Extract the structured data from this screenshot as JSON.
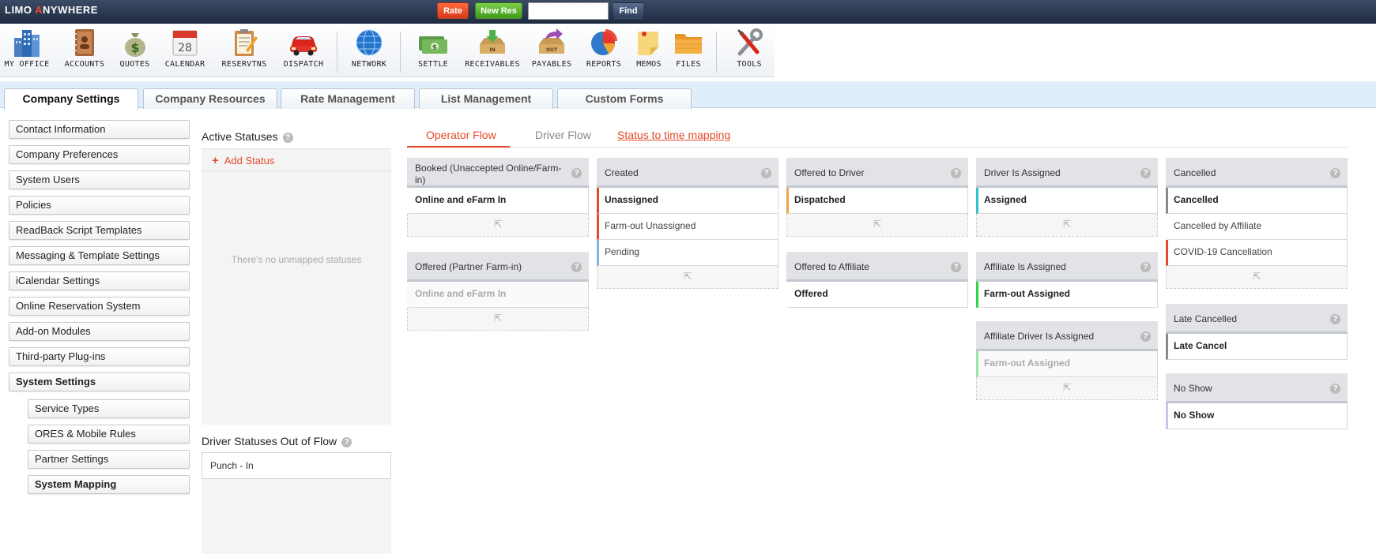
{
  "topbar": {
    "logo_left": "LIMO ",
    "logo_accent": "A",
    "logo_right": "NYWHERE",
    "rate_label": "Rate",
    "new_res_label": "New Res",
    "search_value": "",
    "find_label": "Find"
  },
  "toolbar": [
    {
      "label": "MY OFFICE",
      "icon": "office-building-icon"
    },
    {
      "label": "ACCOUNTS",
      "icon": "address-book-icon"
    },
    {
      "label": "QUOTES",
      "icon": "money-bag-icon"
    },
    {
      "label": "CALENDAR",
      "icon": "calendar-icon",
      "day": "28"
    },
    {
      "label": "RESERVTNS",
      "icon": "clipboard-icon"
    },
    {
      "label": "DISPATCH",
      "icon": "car-icon"
    },
    {
      "label": "NETWORK",
      "icon": "globe-icon"
    },
    {
      "label": "SETTLE",
      "icon": "cash-icon"
    },
    {
      "label": "RECEIVABLES",
      "icon": "inbox-tray-icon",
      "tag": "IN"
    },
    {
      "label": "PAYABLES",
      "icon": "outbox-tray-icon",
      "tag": "OUT"
    },
    {
      "label": "REPORTS",
      "icon": "pie-chart-icon"
    },
    {
      "label": "MEMOS",
      "icon": "sticky-note-icon"
    },
    {
      "label": "FILES",
      "icon": "folder-icon"
    },
    {
      "label": "TOOLS",
      "icon": "wrench-screwdriver-icon"
    }
  ],
  "tabs": [
    {
      "label": "Company Settings",
      "active": true
    },
    {
      "label": "Company Resources"
    },
    {
      "label": "Rate Management"
    },
    {
      "label": "List Management"
    },
    {
      "label": "Custom Forms"
    }
  ],
  "sidebar": {
    "items": [
      "Contact Information",
      "Company Preferences",
      "System Users",
      "Policies",
      "ReadBack Script Templates",
      "Messaging & Template Settings",
      "iCalendar Settings",
      "Online Reservation System",
      "Add-on Modules",
      "Third-party Plug-ins",
      "System Settings"
    ],
    "subitems": [
      "Service Types",
      "ORES & Mobile Rules",
      "Partner Settings",
      "System Mapping"
    ]
  },
  "active_statuses": {
    "title": "Active Statuses",
    "help": "?",
    "add_label": "Add Status",
    "add_icon": "+",
    "empty_text": "There's no unmapped statuses"
  },
  "driver_out_of_flow": {
    "title": "Driver Statuses Out of Flow",
    "help": "?",
    "items": [
      "Punch - In"
    ]
  },
  "flow_tabs": {
    "operator": "Operator Flow",
    "driver": "Driver Flow",
    "mapping": "Status to time mapping"
  },
  "colors": {
    "accent": "#e44a2b",
    "red": "#e44a2b",
    "orange": "#f4a24b",
    "blue": "#7db6e6",
    "teal": "#2ec4c9",
    "green": "#35d14a",
    "light_green": "#9be6a4",
    "gray": "#8a8a8a",
    "lavender": "#c7c4ee"
  },
  "groups": {
    "booked": {
      "title": "Booked (Unaccepted Online/Farm-in)",
      "items": [
        {
          "label": "Online and eFarm In",
          "bold": true
        }
      ]
    },
    "offered_partner": {
      "title": "Offered (Partner Farm-in)",
      "items": [
        {
          "label": "Online and eFarm In",
          "bold": true,
          "faded": true
        }
      ]
    },
    "created": {
      "title": "Created",
      "items": [
        {
          "label": "Unassigned",
          "bold": true,
          "bar": "#e44a2b"
        },
        {
          "label": "Farm-out Unassigned",
          "bar": "#e44a2b"
        },
        {
          "label": "Pending",
          "bar": "#7db6e6"
        }
      ]
    },
    "offered_driver": {
      "title": "Offered to Driver",
      "items": [
        {
          "label": "Dispatched",
          "bold": true,
          "bar": "#f4a24b"
        }
      ]
    },
    "offered_affiliate": {
      "title": "Offered to Affiliate",
      "items": [
        {
          "label": "Offered",
          "bold": true
        }
      ]
    },
    "driver_assigned": {
      "title": "Driver Is Assigned",
      "items": [
        {
          "label": "Assigned",
          "bold": true,
          "bar": "#2ec4c9"
        }
      ]
    },
    "affiliate_assigned": {
      "title": "Affiliate Is Assigned",
      "items": [
        {
          "label": "Farm-out Assigned",
          "bold": true,
          "bar": "#35d14a"
        }
      ]
    },
    "affiliate_driver_assigned": {
      "title": "Affiliate Driver Is Assigned",
      "items": [
        {
          "label": "Farm-out Assigned",
          "bold": true,
          "faded": true,
          "bar": "#9be6a4"
        }
      ]
    },
    "cancelled": {
      "title": "Cancelled",
      "items": [
        {
          "label": "Cancelled",
          "bold": true,
          "bar": "#8a8a8a"
        },
        {
          "label": "Cancelled by Affiliate"
        },
        {
          "label": "COVID-19 Cancellation",
          "bar": "#e44a2b"
        }
      ]
    },
    "late_cancelled": {
      "title": "Late Cancelled",
      "items": [
        {
          "label": "Late Cancel",
          "bold": true,
          "bar": "#8a8a8a"
        }
      ]
    },
    "no_show": {
      "title": "No Show",
      "items": [
        {
          "label": "No Show",
          "bold": true,
          "bar": "#c7c4ee"
        }
      ]
    }
  }
}
